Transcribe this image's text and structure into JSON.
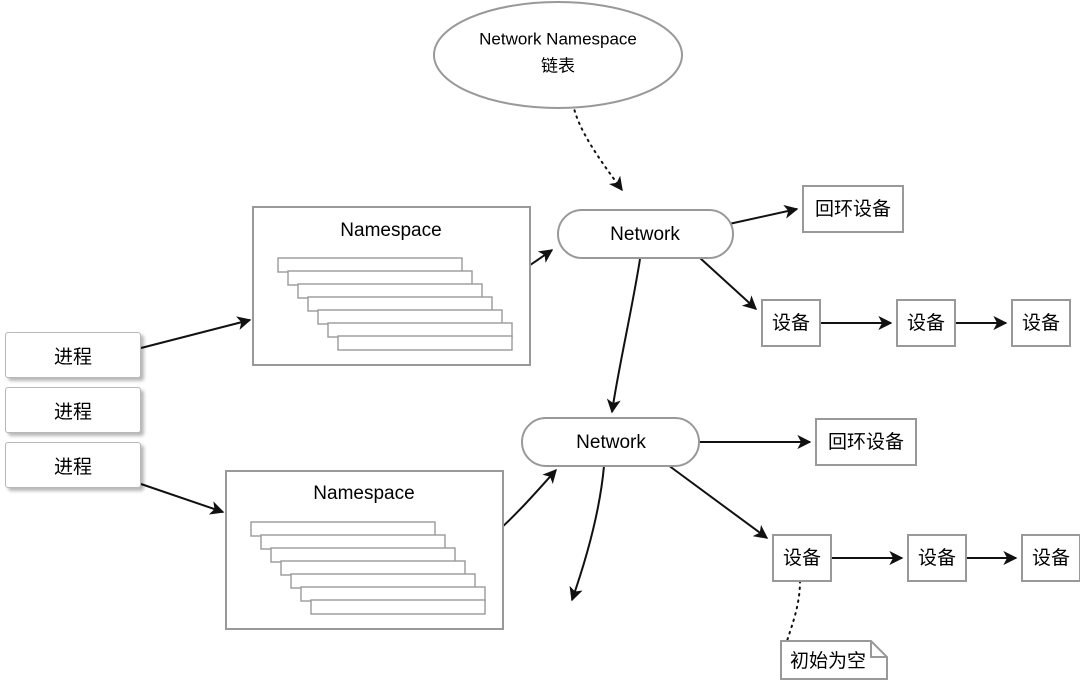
{
  "diagram": {
    "title_node": {
      "id": "network-namespace-list",
      "line1": "Network Namespace",
      "line2": "链表",
      "shape": "ellipse"
    },
    "processes": [
      {
        "id": "process-1",
        "label": "进程"
      },
      {
        "id": "process-2",
        "label": "进程"
      },
      {
        "id": "process-3",
        "label": "进程"
      }
    ],
    "namespaces": [
      {
        "id": "namespace-top",
        "label": "Namespace",
        "card_count": 7
      },
      {
        "id": "namespace-bottom",
        "label": "Namespace",
        "card_count": 7
      }
    ],
    "networks": [
      {
        "id": "network-top",
        "label": "Network"
      },
      {
        "id": "network-bottom",
        "label": "Network"
      }
    ],
    "loopback_devices": [
      {
        "id": "loopback-top",
        "label": "回环设备"
      },
      {
        "id": "loopback-bottom",
        "label": "回环设备"
      }
    ],
    "device_chain_top": [
      {
        "id": "device-top-1",
        "label": "设备"
      },
      {
        "id": "device-top-2",
        "label": "设备"
      },
      {
        "id": "device-top-3",
        "label": "设备"
      }
    ],
    "device_chain_bottom": [
      {
        "id": "device-bottom-1",
        "label": "设备"
      },
      {
        "id": "device-bottom-2",
        "label": "设备"
      },
      {
        "id": "device-bottom-3",
        "label": "设备"
      }
    ],
    "note": {
      "id": "note-initially-empty",
      "label": "初始为空",
      "shape": "folded-corner-note",
      "connector": "dotted"
    },
    "colors": {
      "background": "#ffffff",
      "shape_stroke": "#999999",
      "edge_stroke": "#111111",
      "text": "#000000",
      "card_stroke": "#9a9a9a"
    }
  }
}
